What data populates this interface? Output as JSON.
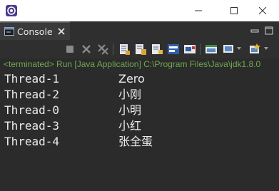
{
  "window": {
    "title": "",
    "buttons": [
      "minimize",
      "maximize",
      "close"
    ]
  },
  "tab": {
    "label": "Console",
    "close_symbol": "✕"
  },
  "status": {
    "terminated": "<terminated>",
    "run": " Run [Java Application] C:\\Program Files\\Java\\jdk1.8.0"
  },
  "output": [
    {
      "thread": "Thread-1",
      "value": "Zero"
    },
    {
      "thread": "Thread-2",
      "value": "小刚"
    },
    {
      "thread": "Thread-0",
      "value": "小明"
    },
    {
      "thread": "Thread-3",
      "value": "小红"
    },
    {
      "thread": "Thread-4",
      "value": "张全蛋"
    }
  ],
  "colors": {
    "console_bg": "#2b2b2b",
    "toolbar_bg": "#2f2f2f",
    "status_text": "#6ea84f",
    "output_text": "#ebebeb"
  },
  "toolbar_icons": [
    "stop-icon",
    "remove-launch-icon",
    "remove-all-terminated-icon",
    "scroll-lock-icon",
    "word-wrap-icon",
    "show-on-stdout-icon",
    "show-on-stderr-icon",
    "pin-console-icon",
    "open-console-icon",
    "new-console-icon"
  ]
}
